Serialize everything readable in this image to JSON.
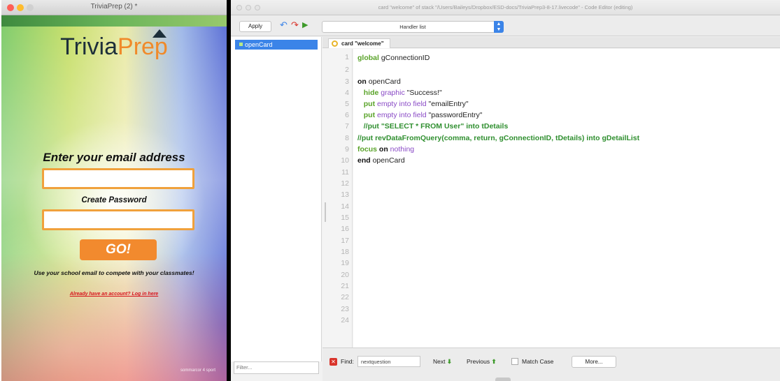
{
  "stack": {
    "window_title": "TriviaPrep (2) *",
    "logo_part1": "Trivia",
    "logo_part2": "Prep",
    "email_heading": "Enter your email address",
    "password_heading": "Create Password",
    "go_label": "GO!",
    "compete_text": "Use your school email to compete with your classmates!",
    "login_link": "Already have an account? Log in here",
    "footer_note": "sommarcor 4 sport",
    "colors": {
      "go_button": "#f28a2e",
      "field_border": "#f0a13c",
      "link": "#d6141c"
    }
  },
  "editor": {
    "window_title": "card \"welcome\" of stack \"/Users/Baileys/Dropbox/ESD-docs/TriviaPrep3-8-17.livecode\" - Code Editor (editing)",
    "apply_label": "Apply",
    "handler_select": "Handler list",
    "handlers": [
      "openCard"
    ],
    "filter_placeholder": "Filter...",
    "tab_label": "card \"welcome\"",
    "line_numbers": [
      "1",
      "2",
      "3",
      "4",
      "5",
      "6",
      "7",
      "8",
      "9",
      "10",
      "11",
      "12",
      "13",
      "14",
      "15",
      "16",
      "17",
      "18",
      "19",
      "20",
      "21",
      "22",
      "23",
      "24"
    ],
    "code": {
      "l1_kw": "global",
      "l1_rest": " gConnectionID",
      "l3_kw": "on",
      "l3_rest": " openCard",
      "l4_cmd": "   hide",
      "l4_sym": " graphic",
      "l4_rest": " \"Success!\"",
      "l5_cmd": "   put",
      "l5_sym": " empty into field",
      "l5_rest": " \"emailEntry\"",
      "l6_cmd": "   put",
      "l6_sym": " empty into field",
      "l6_rest": " \"passwordEntry\"",
      "l7_cmt": "   //put \"SELECT * FROM User\" into tDetails",
      "l8_cmt": "//put revDataFromQuery(comma, return, gConnectionID, tDetails) into gDetailList",
      "l9_cmd": "focus",
      "l9_kw": " on",
      "l9_sym": " nothing",
      "l10_kw": "end",
      "l10_rest": " openCard"
    },
    "find": {
      "label": "Find:",
      "value": "nextquestion",
      "next_label": "Next",
      "previous_label": "Previous",
      "match_case_label": "Match Case",
      "more_label": "More..."
    },
    "colors": {
      "accent": "#3b84e8",
      "keyword_cmd": "#5aa32a",
      "keyword_sym": "#8a4bc6",
      "comment": "#2f8f2f"
    }
  }
}
